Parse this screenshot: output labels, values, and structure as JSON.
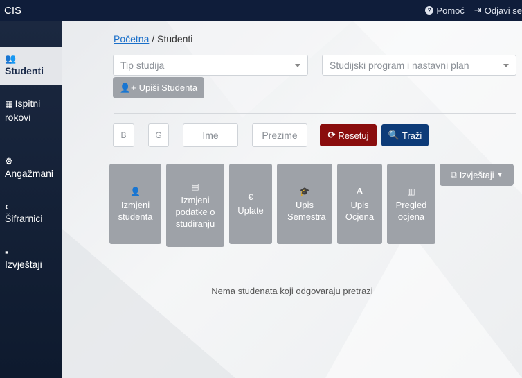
{
  "topbar": {
    "brand": "CIS",
    "help": "Pomoć",
    "logout": "Odjavi se"
  },
  "sidebar": {
    "items": [
      {
        "label": "Studenti",
        "icon": "users-icon"
      },
      {
        "label": "Ispitni rokovi",
        "icon": "calendar-icon"
      },
      {
        "label": "Angažmani",
        "icon": "cogs-icon"
      },
      {
        "label": "Šifrarnici",
        "icon": "chevron-left-icon"
      },
      {
        "label": "Izvještaji",
        "icon": "file-icon"
      }
    ]
  },
  "breadcrumb": {
    "home": "Početna",
    "separator": "/",
    "current": "Studenti"
  },
  "filters": {
    "study_type_placeholder": "Tip studija",
    "program_placeholder": "Studijski program i nastavni plan"
  },
  "enroll_button": "Upiši Studenta",
  "search": {
    "field_b": "B",
    "field_g": "G",
    "first_name": "Ime",
    "last_name": "Prezime",
    "reset": "Resetuj",
    "search": "Traži"
  },
  "actions": {
    "change_student": "Izmjeni studenta",
    "change_data": "Izmjeni podatke o studiranju",
    "payments": "Uplate",
    "semester": "Upis Semestra",
    "grades": "Upis Ocjena",
    "review": "Pregled ocjena",
    "reports": "Izvještaji"
  },
  "empty_message": "Nema studenata koji odgovaraju pretrazi",
  "colors": {
    "topbar": "#0f1d3a",
    "reset": "#8a0d0d",
    "search": "#0d3b78",
    "tile": "#9ea2a8"
  }
}
